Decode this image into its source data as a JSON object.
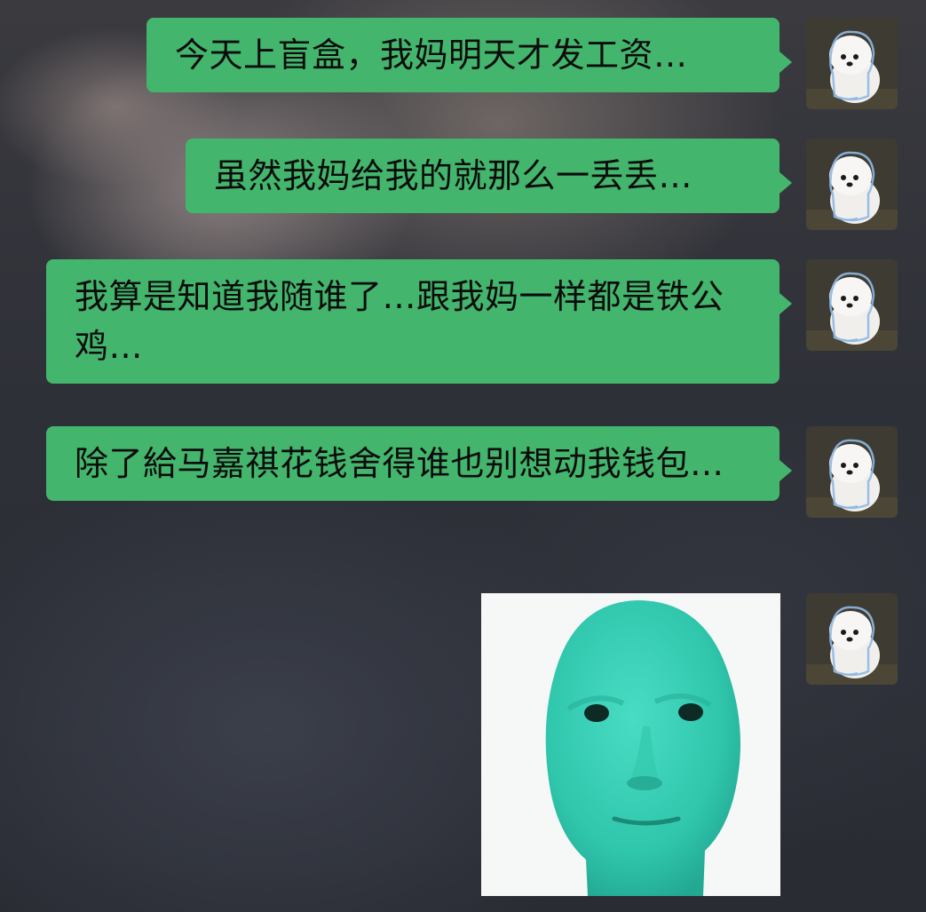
{
  "conversation": {
    "messages": [
      {
        "sender": "self",
        "text": "今天上盲盒，我妈明天才发工资…"
      },
      {
        "sender": "self",
        "text": "虽然我妈给我的就那么一丢丢…"
      },
      {
        "sender": "self",
        "text": "我算是知道我随谁了…跟我妈一样都是铁公鸡…"
      },
      {
        "sender": "self",
        "text": "除了給马嘉祺花钱舍得谁也别想动我钱包…"
      },
      {
        "sender": "self",
        "type": "sticker",
        "sticker": "green-mask-face-icon"
      }
    ]
  },
  "colors": {
    "bubble": "#43b56d",
    "text": "#0c0c0c"
  },
  "icons": {
    "avatar": "white-dog-raincoat-icon",
    "sticker": "green-mask-face-icon"
  }
}
